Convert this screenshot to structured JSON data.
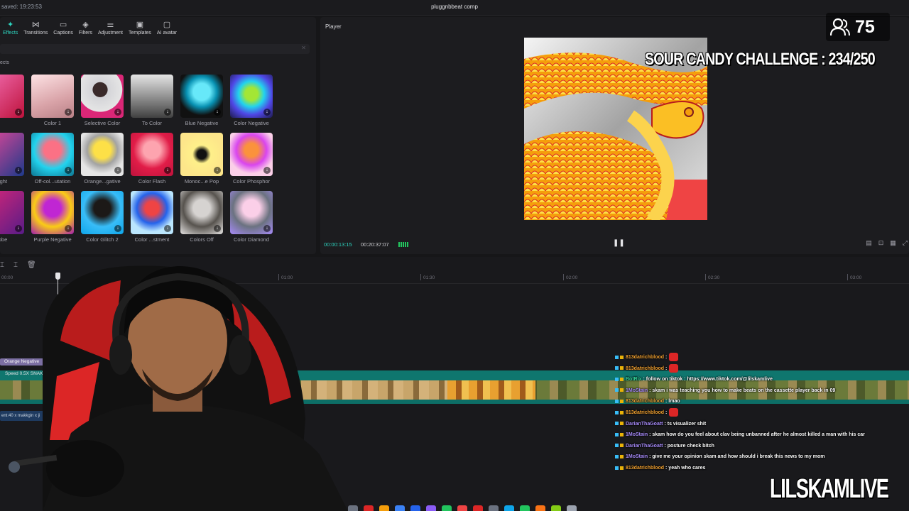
{
  "topbar": {
    "saved_text": "saved: 19:23:53",
    "project_title": "pluggnbbeat comp"
  },
  "toolbar": {
    "items": [
      {
        "label": "Effects",
        "icon": "sparkle-icon",
        "active": true
      },
      {
        "label": "Transitions",
        "icon": "bowtie-icon"
      },
      {
        "label": "Captions",
        "icon": "caption-icon"
      },
      {
        "label": "Filters",
        "icon": "filter-icon"
      },
      {
        "label": "Adjustment",
        "icon": "sliders-icon"
      },
      {
        "label": "Templates",
        "icon": "template-icon"
      },
      {
        "label": "AI avatar",
        "icon": "avatar-icon"
      }
    ]
  },
  "effects_panel": {
    "section_label": "ects",
    "rows": [
      [
        "",
        "Color 1",
        "Selective Color",
        "To Color",
        "Blue Negative",
        "Color Negative"
      ],
      [
        "ight",
        "Off-col...utation",
        "Orange...gative",
        "Color Flash",
        "Monoc...e Pop",
        "Color Phosphor"
      ],
      [
        "obe",
        "Purple Negative",
        "Color Glitch 2",
        "Color ...stment",
        "Colors Off",
        "Color Diamond"
      ]
    ]
  },
  "player": {
    "title": "Player",
    "current_time": "00:00:13:15",
    "duration": "00:20:37:07"
  },
  "overlay": {
    "viewer_count": "75",
    "challenge_text": "SOUR CANDY CHALLENGE : 234/250",
    "channel_handle": "LILSKAMLIVE"
  },
  "timeline": {
    "ruler_ticks": [
      "00:00",
      "01:00",
      "01:30",
      "02:00",
      "02:30",
      "03:00"
    ],
    "effect_clip_label": "Orange Negative",
    "main_track_label": "Speed 0.5X   SNAKE",
    "audio_clip_label": "ent:40 x makkgin x ji"
  },
  "chat": {
    "messages": [
      {
        "user": "813datrichblood",
        "text": ":",
        "color": "#f0a030",
        "emote": true
      },
      {
        "user": "813datrichblood",
        "text": ":",
        "color": "#f0a030",
        "emote": true
      },
      {
        "user": "BotRix",
        "text": ": follow on tiktok : https://www.tiktok.com/@lilskamlive",
        "color": "#34d399",
        "emote": false
      },
      {
        "user": "1MoStain",
        "text": ": skam i was teaching you how to make beats on the cassette player back in 09",
        "color": "#a78bfa",
        "emote": false
      },
      {
        "user": "813datrichblood",
        "text": ": lmao",
        "color": "#f0a030",
        "emote": false
      },
      {
        "user": "813datrichblood",
        "text": ":",
        "color": "#f0a030",
        "emote": true
      },
      {
        "user": "DarianThaGoatt",
        "text": ": ts visualizer shit",
        "color": "#a78bfa",
        "emote": false
      },
      {
        "user": "1MoStain",
        "text": ": skam how do you feel about clav being unbanned after he almost killed a man with his car",
        "color": "#a78bfa",
        "emote": false
      },
      {
        "user": "DarianThaGoatt",
        "text": ": posture check bitch",
        "color": "#a78bfa",
        "emote": false
      },
      {
        "user": "1MoStain",
        "text": ": give me your opinion skam and how should i break this news to my mom",
        "color": "#a78bfa",
        "emote": false
      },
      {
        "user": "813datrichblood",
        "text": ": yeah who cares",
        "color": "#f0a030",
        "emote": false
      }
    ]
  },
  "colors": {
    "accent": "#2dd4bf",
    "panel": "#1c1c1f",
    "track": "#0f766e"
  }
}
